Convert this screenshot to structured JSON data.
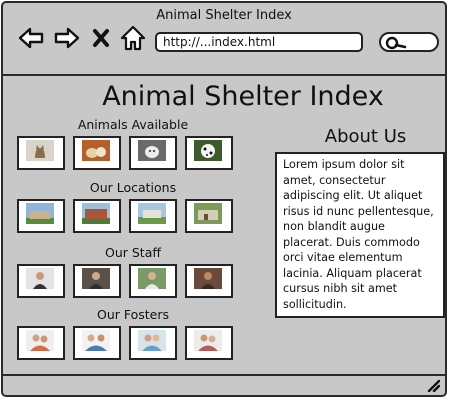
{
  "window": {
    "title": "Animal Shelter Index"
  },
  "toolbar": {
    "back_icon": "back-arrow-icon",
    "forward_icon": "forward-arrow-icon",
    "close_icon": "close-x-icon",
    "home_icon": "home-icon",
    "url": "http://...index.html",
    "search_icon": "search-icon"
  },
  "page": {
    "title": "Animal Shelter Index"
  },
  "sections": [
    {
      "label": "Animals Available",
      "photos": [
        "cat",
        "puppies",
        "puppy",
        "dalmatian"
      ]
    },
    {
      "label": "Our Locations",
      "photos": [
        "building",
        "building",
        "building",
        "building"
      ]
    },
    {
      "label": "Our Staff",
      "photos": [
        "person",
        "person",
        "person",
        "person"
      ]
    },
    {
      "label": "Our Fosters",
      "photos": [
        "family",
        "family",
        "family",
        "family"
      ]
    }
  ],
  "about": {
    "title": "About Us",
    "body": "Lorem ipsum dolor sit amet, consectetur adipiscing elit. Ut aliquet risus id nunc pellentesque, non blandit augue placerat. Duis commodo orci vitae elementum lacinia. Aliquam placerat cursus nibh sit amet sollicitudin."
  },
  "colors": {
    "window_bg": "#c8c8c8",
    "border": "#2a2a2a",
    "panel": "#ffffff"
  }
}
